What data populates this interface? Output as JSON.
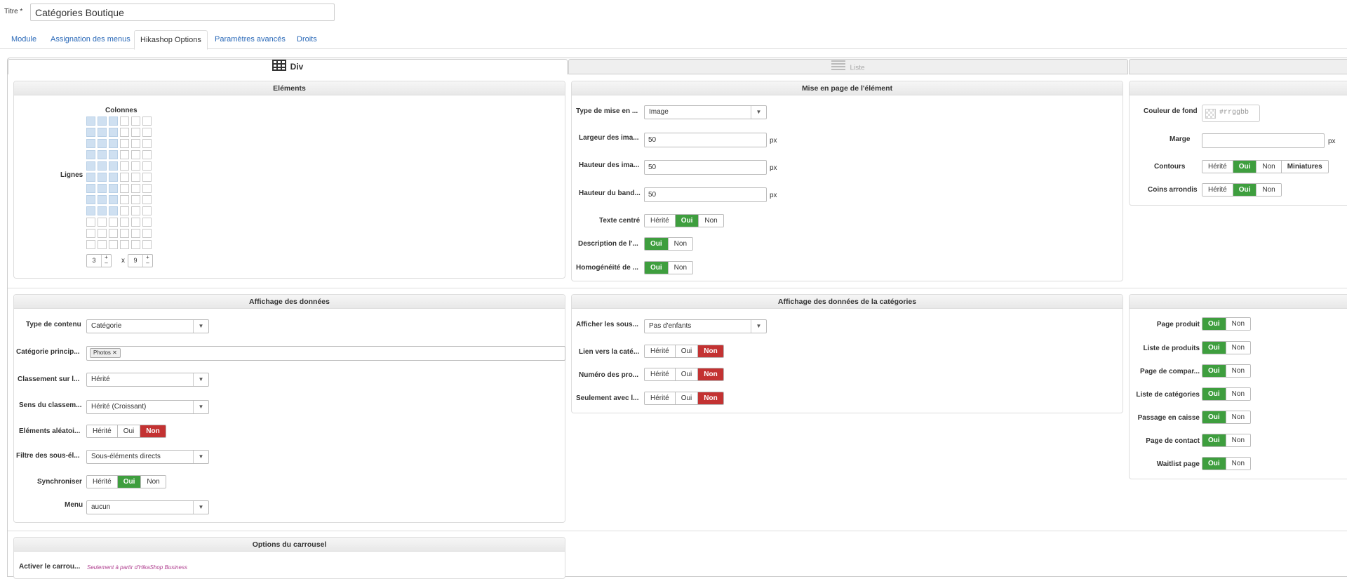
{
  "header": {
    "title_label": "Titre *",
    "title_value": "Catégories Boutique"
  },
  "tabs": [
    {
      "label": "Module"
    },
    {
      "label": "Assignation des menus"
    },
    {
      "label": "Hikashop Options"
    },
    {
      "label": "Paramètres avancés"
    },
    {
      "label": "Droits"
    }
  ],
  "layout_tabs": {
    "div_label": "Div",
    "list_label": "Liste"
  },
  "elements": {
    "title": "Eléments",
    "columns_label": "Colonnes",
    "rows_label": "Lignes",
    "columns_value": "3",
    "rows_value": "9",
    "times": "x",
    "plus": "+",
    "minus": "–",
    "grid_total_columns": 6,
    "grid_total_rows": 12,
    "grid_selected_columns": 3,
    "grid_selected_rows": 9
  },
  "mise_en_page": {
    "title": "Mise en page de l'élément",
    "type_label": "Type de mise en ...",
    "type_value": "Image",
    "largeur_label": "Largeur des ima...",
    "largeur_value": "50",
    "hauteur_label": "Hauteur des ima...",
    "hauteur_value": "50",
    "bandeau_label": "Hauteur du band...",
    "bandeau_value": "50",
    "unit": "px",
    "texte_centre_label": "Texte centré",
    "description_label": "Description de l'...",
    "homogeneite_label": "Homogénéité de ..."
  },
  "style_panel": {
    "couleur_label": "Couleur de fond",
    "couleur_placeholder": "#rrggbb",
    "marge_label": "Marge",
    "marge_unit": "px",
    "contours_label": "Contours",
    "coins_label": "Coins arrondis",
    "miniatures": "Miniatures"
  },
  "buttons": {
    "herite": "Hérité",
    "oui": "Oui",
    "non": "Non"
  },
  "affichage": {
    "title": "Affichage des données",
    "type_contenu_label": "Type de contenu",
    "type_contenu_value": "Catégorie",
    "categorie_label": "Catégorie princip...",
    "categorie_tag": "Photos",
    "tag_close": "✕",
    "classement_label": "Classement sur l...",
    "classement_value": "Hérité",
    "sens_label": "Sens du classem...",
    "sens_value": "Hérité (Croissant)",
    "aleatoire_label": "Eléments aléatoi...",
    "filtre_label": "Filtre des sous-él...",
    "filtre_value": "Sous-éléments directs",
    "synchroniser_label": "Synchroniser",
    "menu_label": "Menu",
    "menu_value": "aucun"
  },
  "affichage_cat": {
    "title": "Affichage des données de la catégories",
    "sous_label": "Afficher les sous...",
    "sous_value": "Pas d'enfants",
    "lien_label": "Lien vers la caté...",
    "numero_label": "Numéro des pro...",
    "seulement_label": "Seulement avec l..."
  },
  "pages": {
    "items": [
      {
        "label": "Page produit"
      },
      {
        "label": "Liste de produits"
      },
      {
        "label": "Page de compar..."
      },
      {
        "label": "Liste de catégories"
      },
      {
        "label": "Passage en caisse"
      },
      {
        "label": "Page de contact"
      },
      {
        "label": "Waitlist page"
      }
    ]
  },
  "carrousel": {
    "title": "Options du carrousel",
    "activer_label": "Activer le carrou...",
    "note": "Seulement à partir d'HikaShop Business"
  },
  "colors": {
    "active_green": "#3e9e3e",
    "active_red": "#c33232",
    "link": "#2a69b8",
    "grid_fill": "#cfe0f1"
  }
}
